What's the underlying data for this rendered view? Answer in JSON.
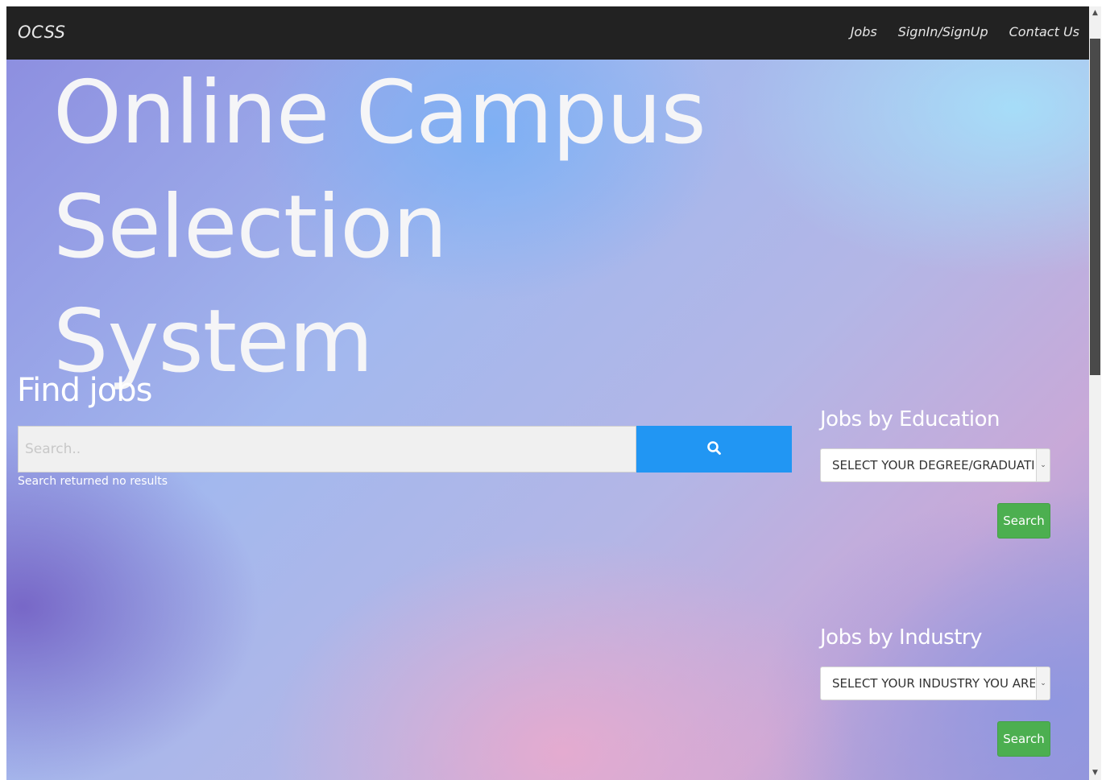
{
  "navbar": {
    "brand": "OCSS",
    "links": [
      "Jobs",
      "SignIn/SignUp",
      "Contact Us"
    ]
  },
  "hero": {
    "title_line1": "Online Campus Selection",
    "title_line2": "System"
  },
  "find_jobs": {
    "title": "Find jobs",
    "search_placeholder": "Search..",
    "search_icon": "search-icon",
    "result_text": "Search returned no results"
  },
  "education": {
    "title": "Jobs by Education",
    "select_value": "SELECT YOUR DEGREE/GRADUATION",
    "button_label": "Search"
  },
  "industry": {
    "title": "Jobs by Industry",
    "select_value": "SELECT YOUR INDUSTRY YOU ARE INTERESTED IN",
    "button_label": "Search"
  },
  "colors": {
    "navbar_bg": "#222222",
    "search_button": "#2196f3",
    "green_button": "#4caf50"
  }
}
